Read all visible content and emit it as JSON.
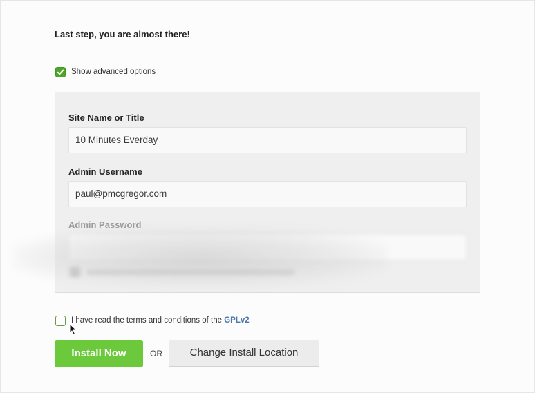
{
  "heading": "Last step, you are almost there!",
  "advanced_options": {
    "label": "Show advanced options",
    "checked": true
  },
  "form": {
    "site_name": {
      "label": "Site Name or Title",
      "value": "10 Minutes Everday"
    },
    "admin_username": {
      "label": "Admin Username",
      "value": "paul@pmcgregor.com"
    },
    "admin_password": {
      "label": "Admin Password",
      "value": ""
    }
  },
  "terms": {
    "text": "I have read the terms and conditions of the",
    "link": "GPLv2",
    "checked": false
  },
  "buttons": {
    "install": "Install Now",
    "or": "OR",
    "change_location": "Change Install Location"
  },
  "colors": {
    "accent_green": "#6cc93b",
    "checkbox_green": "#4fa52a",
    "link_blue": "#4a76a8"
  }
}
